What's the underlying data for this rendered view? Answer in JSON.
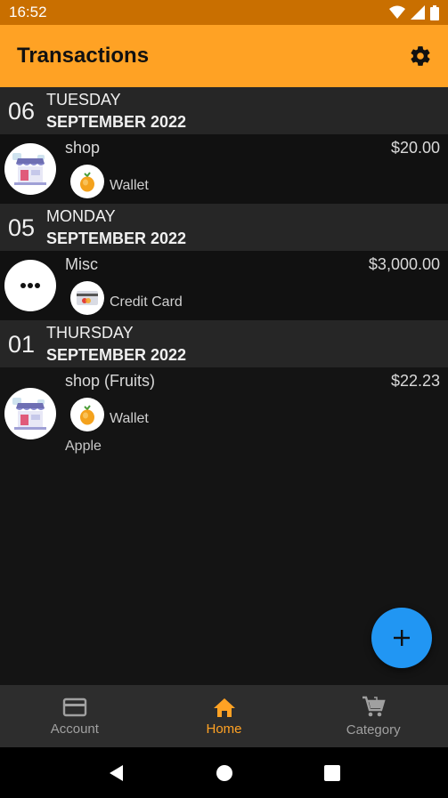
{
  "status_bar": {
    "time": "16:52"
  },
  "app_bar": {
    "title": "Transactions"
  },
  "groups": [
    {
      "day": "06",
      "weekday": "TUESDAY",
      "month_year": "SEPTEMBER 2022",
      "transactions": [
        {
          "title": "shop",
          "amount": "$20.00",
          "account": "Wallet",
          "category_icon": "shop-icon",
          "account_icon": "wallet-icon",
          "note": ""
        }
      ]
    },
    {
      "day": "05",
      "weekday": "MONDAY",
      "month_year": "SEPTEMBER 2022",
      "transactions": [
        {
          "title": "Misc",
          "amount": "$3,000.00",
          "account": "Credit Card",
          "category_icon": "more-icon",
          "account_icon": "credit-card-icon",
          "note": ""
        }
      ]
    },
    {
      "day": "01",
      "weekday": "THURSDAY",
      "month_year": "SEPTEMBER 2022",
      "transactions": [
        {
          "title": "shop (Fruits)",
          "amount": "$22.23",
          "account": "Wallet",
          "category_icon": "shop-icon",
          "account_icon": "wallet-icon",
          "note": "Apple"
        }
      ]
    }
  ],
  "bottom_nav": [
    {
      "label": "Account",
      "icon": "card-icon",
      "active": false
    },
    {
      "label": "Home",
      "icon": "home-icon",
      "active": true
    },
    {
      "label": "Category",
      "icon": "cart-icon",
      "active": false
    }
  ],
  "colors": {
    "app_bar": "#ffa224",
    "status_bar": "#c96f00",
    "fab": "#2196f3",
    "active_nav": "#ffa224"
  }
}
